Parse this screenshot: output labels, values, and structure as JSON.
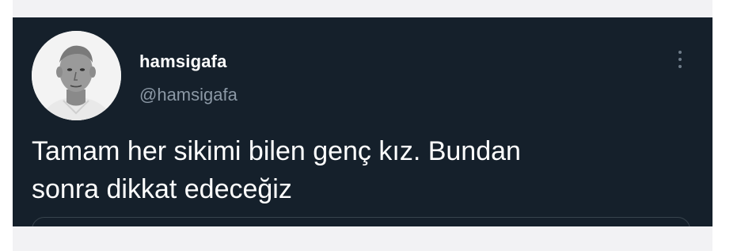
{
  "tweet": {
    "display_name": "hamsigafa",
    "handle": "@hamsigafa",
    "text_line_1": "Tamam her sikimi bilen genç kız. Bundan",
    "text_line_2": "sonra dikkat edeceğiz",
    "avatar_icon": "profile-photo",
    "more_icon": "more-vertical-icon"
  },
  "colors": {
    "card_background": "#15202b",
    "name_text": "#ffffff",
    "handle_text": "#8b98a5",
    "page_strip": "#f2f2f4"
  }
}
